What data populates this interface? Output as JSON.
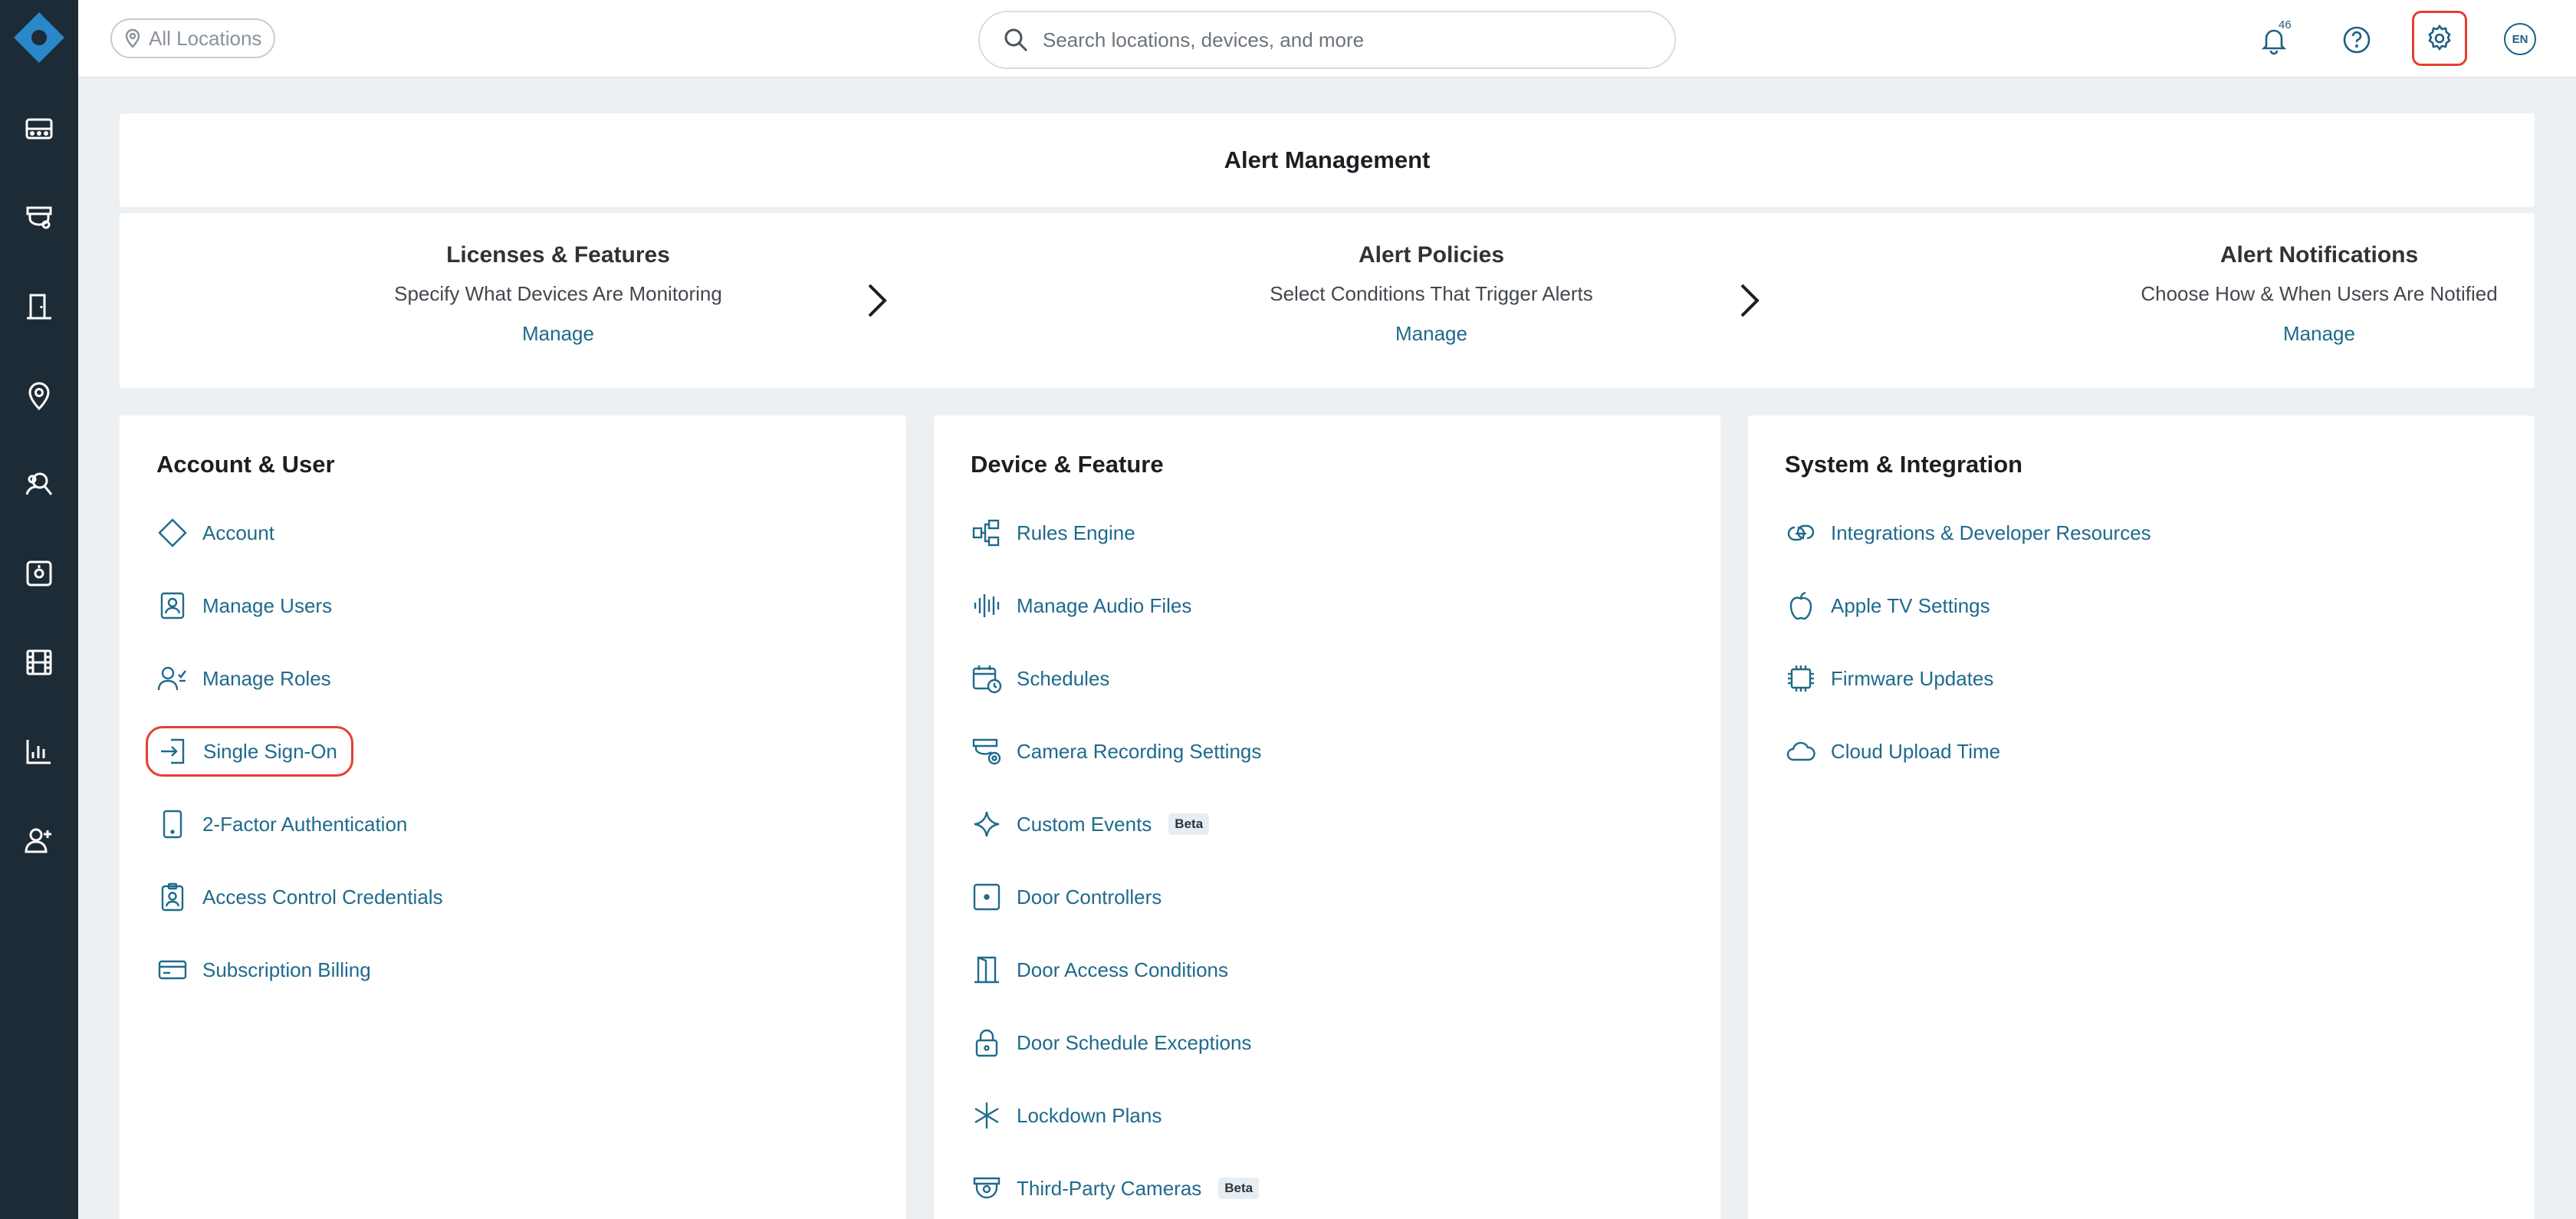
{
  "header": {
    "location_label": "All Locations",
    "search_placeholder": "Search locations, devices, and more",
    "notification_count": "46",
    "language": "EN"
  },
  "sidebar": {
    "icons": [
      "dashboard-icon",
      "camera-icon",
      "door-icon",
      "location-icon",
      "people-search-icon",
      "access-panel-icon",
      "film-icon",
      "analytics-icon",
      "add-user-icon"
    ]
  },
  "alert_management": {
    "title": "Alert Management",
    "steps": [
      {
        "title": "Licenses & Features",
        "desc": "Specify What Devices Are Monitoring",
        "action": "Manage"
      },
      {
        "title": "Alert Policies",
        "desc": "Select Conditions That Trigger Alerts",
        "action": "Manage"
      },
      {
        "title": "Alert Notifications",
        "desc": "Choose How & When Users Are Notified",
        "action": "Manage"
      }
    ]
  },
  "account_user": {
    "title": "Account & User",
    "items": [
      {
        "label": "Account",
        "icon": "diamond-icon"
      },
      {
        "label": "Manage Users",
        "icon": "user-card-icon"
      },
      {
        "label": "Manage Roles",
        "icon": "user-check-icon"
      },
      {
        "label": "Single Sign-On",
        "icon": "sign-in-icon"
      },
      {
        "label": "2-Factor Authentication",
        "icon": "phone-icon"
      },
      {
        "label": "Access Control Credentials",
        "icon": "badge-icon"
      },
      {
        "label": "Subscription Billing",
        "icon": "credit-card-icon"
      }
    ]
  },
  "device_feature": {
    "title": "Device & Feature",
    "items": [
      {
        "label": "Rules Engine",
        "icon": "rules-icon"
      },
      {
        "label": "Manage Audio Files",
        "icon": "audio-icon"
      },
      {
        "label": "Schedules",
        "icon": "calendar-clock-icon"
      },
      {
        "label": "Camera Recording Settings",
        "icon": "camera-settings-icon"
      },
      {
        "label": "Custom Events",
        "icon": "sparkle-icon",
        "badge": "Beta"
      },
      {
        "label": "Door Controllers",
        "icon": "door-controller-icon"
      },
      {
        "label": "Door Access Conditions",
        "icon": "door-icon"
      },
      {
        "label": "Door Schedule Exceptions",
        "icon": "lock-icon"
      },
      {
        "label": "Lockdown Plans",
        "icon": "asterisk-icon"
      },
      {
        "label": "Third-Party Cameras",
        "icon": "dome-camera-icon",
        "badge": "Beta"
      }
    ]
  },
  "system_integration": {
    "title": "System & Integration",
    "items": [
      {
        "label": "Integrations & Developer Resources",
        "icon": "link-icon"
      },
      {
        "label": "Apple TV Settings",
        "icon": "apple-icon"
      },
      {
        "label": "Firmware Updates",
        "icon": "chip-icon"
      },
      {
        "label": "Cloud Upload Time",
        "icon": "cloud-icon"
      }
    ]
  }
}
